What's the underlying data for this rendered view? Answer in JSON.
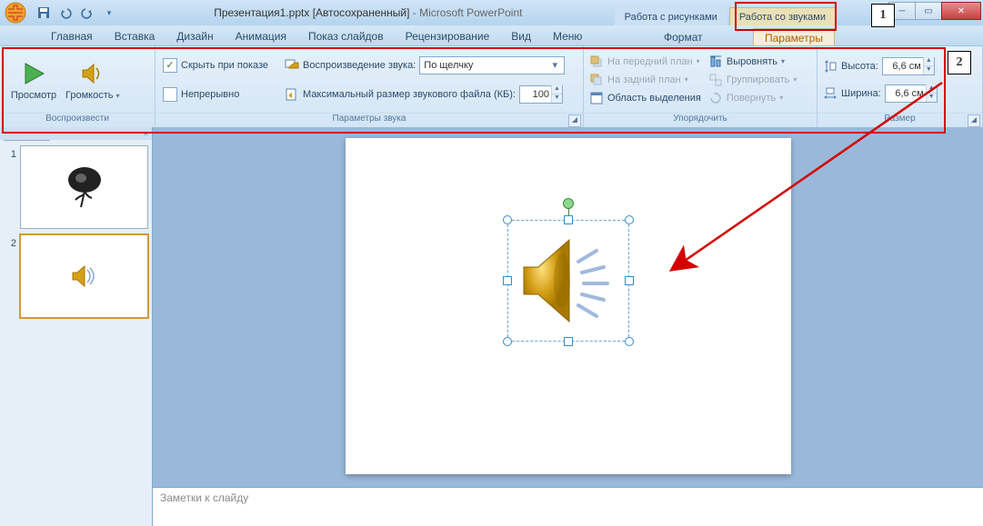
{
  "title": {
    "doc": "Презентация1.pptx [Автосохраненный]",
    "app": "Microsoft PowerPoint"
  },
  "context_tabs": {
    "pictures": "Работа с рисунками",
    "audio": "Работа со звуками"
  },
  "callouts": {
    "c1": "1",
    "c2": "2"
  },
  "tabs": {
    "home": "Главная",
    "insert": "Вставка",
    "design": "Дизайн",
    "animation": "Анимация",
    "slideshow": "Показ слайдов",
    "review": "Рецензирование",
    "view": "Вид",
    "menu": "Меню",
    "format": "Формат",
    "options": "Параметры"
  },
  "ribbon": {
    "play": {
      "preview": "Просмотр",
      "volume": "Громкость",
      "group": "Воспроизвести"
    },
    "sound_opts": {
      "hide": "Скрыть при показе",
      "loop": "Непрерывно",
      "play_label": "Воспроизведение звука:",
      "play_value": "По щелчку",
      "maxsize_label": "Максимальный размер звукового файла (КБ):",
      "maxsize_value": "100",
      "group": "Параметры звука"
    },
    "arrange": {
      "front": "На передний план",
      "back": "На задний план",
      "selpane": "Область выделения",
      "align": "Выровнять",
      "group_cmd": "Группировать",
      "rotate": "Повернуть",
      "group": "Упорядочить"
    },
    "size": {
      "height_label": "Высота:",
      "height_value": "6,6 см",
      "width_label": "Ширина:",
      "width_value": "6,6 см",
      "group": "Размер"
    }
  },
  "slides": {
    "s1": "1",
    "s2": "2"
  },
  "notes": {
    "placeholder": "Заметки к слайду"
  }
}
